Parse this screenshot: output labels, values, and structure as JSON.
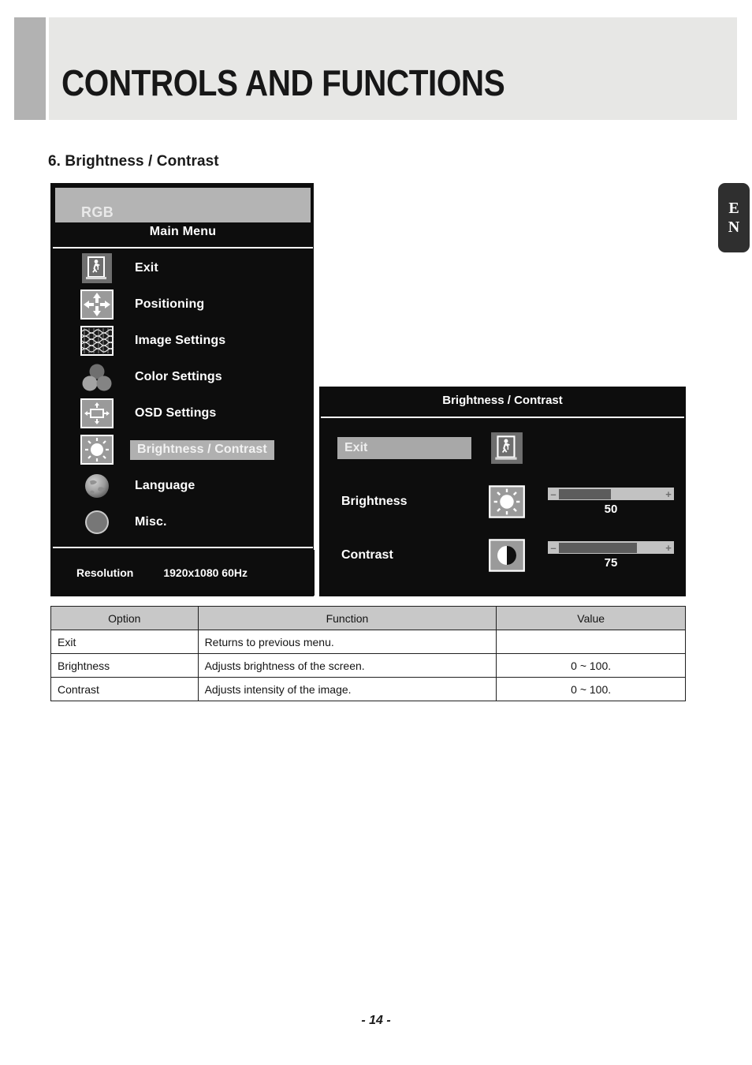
{
  "header": {
    "title": "CONTROLS AND FUNCTIONS",
    "tab_accent_color": "#b2b2b2",
    "band_color": "#e7e7e5"
  },
  "language_tab": {
    "line1": "E",
    "line2": "N"
  },
  "section": {
    "heading": "6. Brightness / Contrast"
  },
  "osd_main_menu": {
    "source_label": "RGB",
    "title": "Main Menu",
    "items": [
      {
        "label": "Exit",
        "icon": "exit-door-icon",
        "selected": false
      },
      {
        "label": "Positioning",
        "icon": "four-way-arrows-icon",
        "selected": false
      },
      {
        "label": "Image Settings",
        "icon": "moire-pattern-icon",
        "selected": false
      },
      {
        "label": "Color Settings",
        "icon": "color-circles-icon",
        "selected": false
      },
      {
        "label": "OSD Settings",
        "icon": "osd-box-arrows-icon",
        "selected": false
      },
      {
        "label": "Brightness / Contrast",
        "icon": "sun-icon",
        "selected": true
      },
      {
        "label": "Language",
        "icon": "globe-icon",
        "selected": false
      },
      {
        "label": "Misc.",
        "icon": "circle-icon",
        "selected": false
      }
    ],
    "footer": {
      "label": "Resolution",
      "value": "1920x1080 60Hz"
    },
    "highlight_color": "#b0b0b0",
    "background_color": "#0d0d0d"
  },
  "osd_sub_menu": {
    "title": "Brightness / Contrast",
    "rows": [
      {
        "label": "Exit",
        "icon": "exit-door-icon",
        "selected": true,
        "has_slider": false,
        "value": null,
        "percent": 0
      },
      {
        "label": "Brightness",
        "icon": "sun-icon",
        "selected": false,
        "has_slider": true,
        "value": "50",
        "percent": 50,
        "minus_label": "–",
        "plus_label": "+"
      },
      {
        "label": "Contrast",
        "icon": "half-circle-icon",
        "selected": false,
        "has_slider": true,
        "value": "75",
        "percent": 75,
        "minus_label": "–",
        "plus_label": "+"
      }
    ],
    "slider_track_color": "#c2c2c2",
    "slider_fill_color": "#5c5c5c"
  },
  "table": {
    "headers": [
      "Option",
      "Function",
      "Value"
    ],
    "rows": [
      {
        "option": "Exit",
        "function": "Returns to previous menu.",
        "value": ""
      },
      {
        "option": "Brightness",
        "function": "Adjusts brightness of the screen.",
        "value": "0 ~ 100."
      },
      {
        "option": "Contrast",
        "function": "Adjusts intensity of the image.",
        "value": "0 ~ 100."
      }
    ],
    "header_background": "#c8c8c8"
  },
  "footer": {
    "page_number": "- 14 -"
  }
}
